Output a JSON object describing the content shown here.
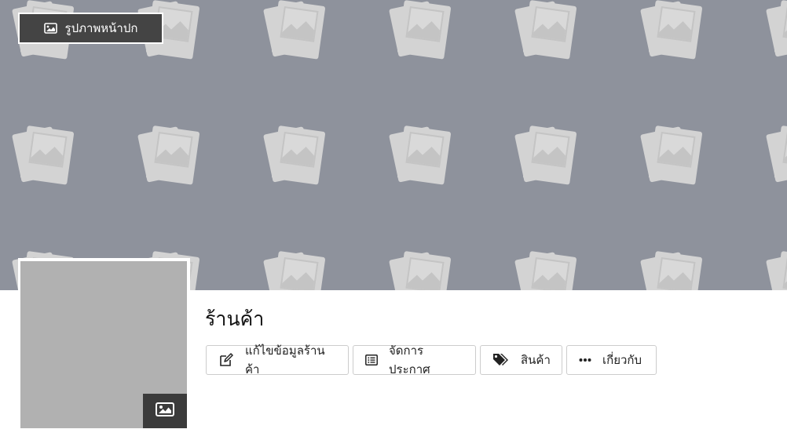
{
  "cover": {
    "button_label": "รูปภาพหน้าปก",
    "button_icon": "image-icon",
    "background_color": "#8e929c",
    "pattern_icon": "photo-placeholder-icon"
  },
  "avatar": {
    "placeholder_color": "#b1b1b1",
    "button_icon": "image-icon"
  },
  "shop": {
    "name": "ร้านค้า"
  },
  "actions": [
    {
      "label": "แก้ไขข้อมูลร้านค้า",
      "icon": "edit-icon"
    },
    {
      "label": "จัดการประกาศ",
      "icon": "list-icon"
    },
    {
      "label": "สินค้า",
      "icon": "tags-icon"
    },
    {
      "label": "เกี่ยวกับ",
      "icon": "more-dots-icon"
    }
  ]
}
